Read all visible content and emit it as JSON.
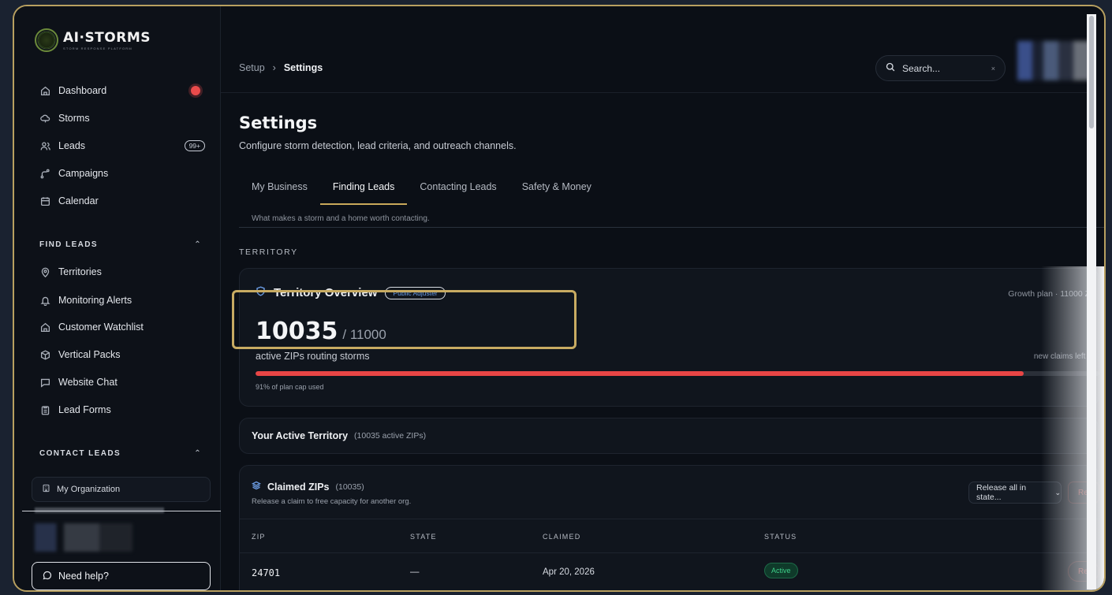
{
  "brand": {
    "name": "AI·STORMS",
    "tagline": "STORM RESPONSE PLATFORM"
  },
  "sidebar": {
    "items": [
      {
        "label": "Dashboard",
        "icon": "home-icon"
      },
      {
        "label": "Storms",
        "icon": "cloud-icon"
      },
      {
        "label": "Leads",
        "icon": "users-icon",
        "badge": "99+"
      },
      {
        "label": "Campaigns",
        "icon": "route-icon"
      },
      {
        "label": "Calendar",
        "icon": "calendar-icon"
      }
    ],
    "find_leads": {
      "heading": "FIND LEADS",
      "items": [
        {
          "label": "Territories",
          "icon": "map-pin-icon"
        },
        {
          "label": "Monitoring Alerts",
          "icon": "bell-icon"
        },
        {
          "label": "Customer Watchlist",
          "icon": "home-icon"
        },
        {
          "label": "Vertical Packs",
          "icon": "package-icon"
        },
        {
          "label": "Website Chat",
          "icon": "chat-icon"
        },
        {
          "label": "Lead Forms",
          "icon": "clipboard-icon"
        }
      ]
    },
    "contact_leads": {
      "heading": "CONTACT LEADS"
    },
    "org": "My Organization",
    "help": "Need help?"
  },
  "topbar": {
    "breadcrumb": [
      "Setup",
      "Settings"
    ],
    "search_placeholder": "Search...",
    "search_clear": "×"
  },
  "page": {
    "title": "Settings",
    "subtitle": "Configure storm detection, lead criteria, and outreach channels.",
    "tabs": [
      "My Business",
      "Finding Leads",
      "Contacting Leads",
      "Safety & Money"
    ],
    "active_tab": "Finding Leads",
    "tab_hint": "What makes a storm and a home worth contacting."
  },
  "territory": {
    "section_label": "TERRITORY",
    "overview": {
      "title": "Territory Overview",
      "pill": "Public Adjuster",
      "plan": "Growth plan · 11000 Z",
      "active": "10035",
      "cap": "/ 11000",
      "active_label": "active ZIPs routing storms",
      "claims_left": "new claims left t",
      "usage_fraction": 0.91,
      "usage_label": "91% of plan cap used"
    },
    "active_territory": {
      "title": "Your Active Territory",
      "count": "(10035 active ZIPs)"
    },
    "claimed": {
      "title": "Claimed ZIPs",
      "count": "(10035)",
      "subtitle": "Release a claim to free capacity for another org.",
      "release_label": "Release all in state...",
      "ghost_label": "Re",
      "columns": [
        "ZIP",
        "STATE",
        "CLAIMED",
        "STATUS"
      ],
      "rows": [
        {
          "zip": "24701",
          "state": "—",
          "claimed": "Apr 20, 2026",
          "status": "Active",
          "action": "Re"
        }
      ]
    }
  },
  "colors": {
    "accent": "#c9a95a",
    "danger": "#e84545",
    "success": "#3ed08a",
    "link": "#6a9ae0"
  }
}
